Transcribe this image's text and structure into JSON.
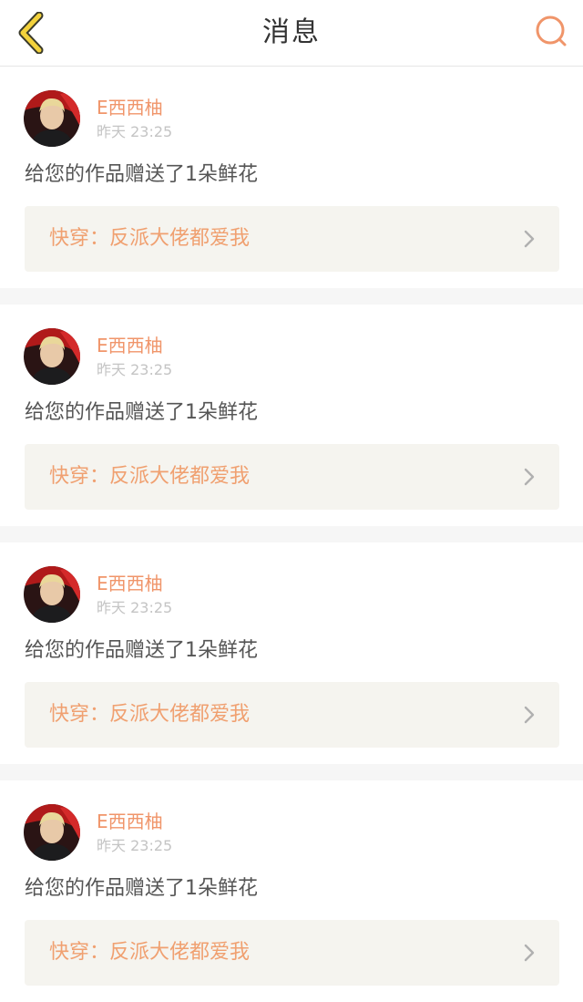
{
  "header": {
    "title": "消息",
    "back_icon": "chevron-left-icon",
    "search_icon": "search-icon",
    "accent_color": "#f0956a",
    "back_color": "#f3d23c"
  },
  "messages": [
    {
      "user_name": "E西西柚",
      "time": "昨天 23:25",
      "text": "给您的作品赠送了1朵鲜花",
      "work_title": "快穿：反派大佬都爱我"
    },
    {
      "user_name": "E西西柚",
      "time": "昨天 23:25",
      "text": "给您的作品赠送了1朵鲜花",
      "work_title": "快穿：反派大佬都爱我"
    },
    {
      "user_name": "E西西柚",
      "time": "昨天 23:25",
      "text": "给您的作品赠送了1朵鲜花",
      "work_title": "快穿：反派大佬都爱我"
    },
    {
      "user_name": "E西西柚",
      "time": "昨天 23:25",
      "text": "给您的作品赠送了1朵鲜花",
      "work_title": "快穿：反派大佬都爱我"
    }
  ]
}
